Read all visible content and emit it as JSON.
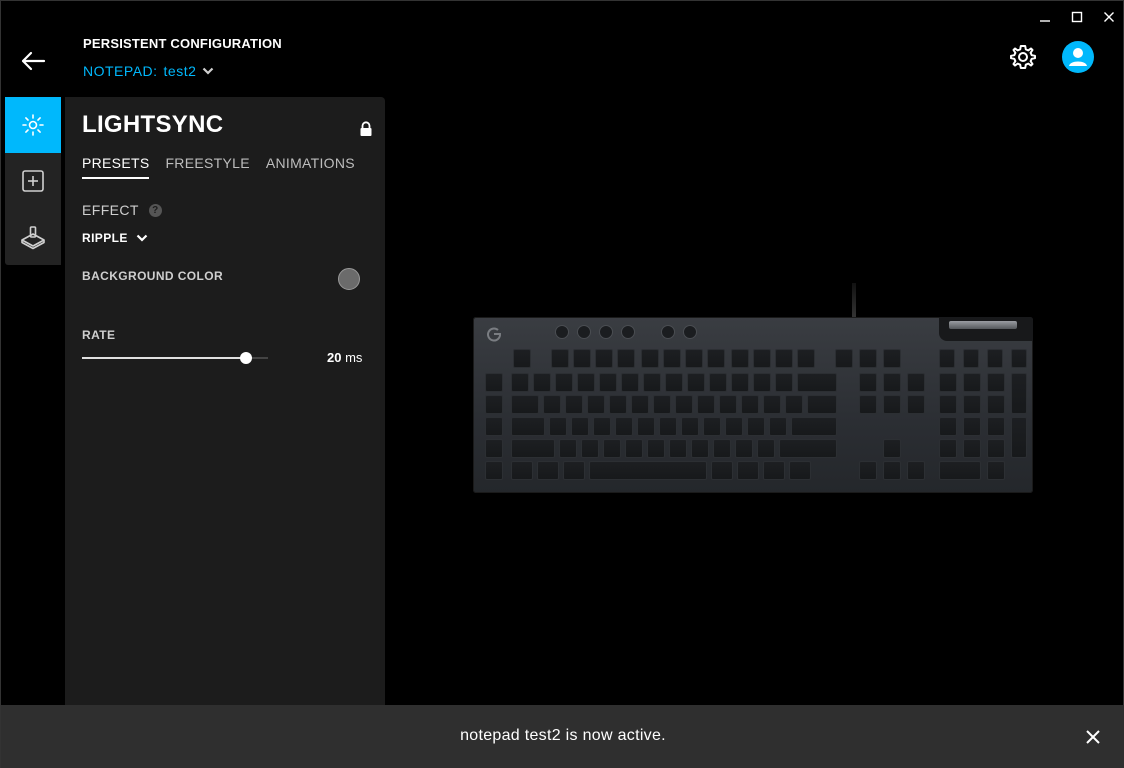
{
  "window": {
    "controls": [
      "minimize-icon",
      "maximize-icon",
      "close-icon"
    ]
  },
  "header": {
    "config_label": "PERSISTENT CONFIGURATION",
    "profile_prefix": "NOTEPAD:",
    "profile_name": "test2",
    "icons": [
      "back-arrow-icon",
      "chevron-down-icon",
      "gear-icon",
      "user-icon"
    ]
  },
  "rail": {
    "items": [
      {
        "icon": "lightsync-icon",
        "active": true
      },
      {
        "icon": "assignments-icon",
        "active": false
      },
      {
        "icon": "game-mode-icon",
        "active": false
      }
    ]
  },
  "panel": {
    "title": "LIGHTSYNC",
    "tabs": [
      {
        "label": "PRESETS",
        "active": true
      },
      {
        "label": "FREESTYLE",
        "active": false
      },
      {
        "label": "ANIMATIONS",
        "active": false
      }
    ],
    "effect_label": "EFFECT",
    "effect_help": "?",
    "effect_value": "RIPPLE",
    "background_color_label": "BACKGROUND COLOR",
    "background_color": "#6b6b6b",
    "rate_label": "RATE",
    "rate_value": "20",
    "rate_unit": "ms",
    "rate_slider_fraction": 0.88
  },
  "toast": {
    "message": "notepad test2 is now active."
  },
  "colors": {
    "accent": "#00b8fc",
    "panel_bg": "#1c1c1c",
    "toast_bg": "#2f2f2f"
  }
}
